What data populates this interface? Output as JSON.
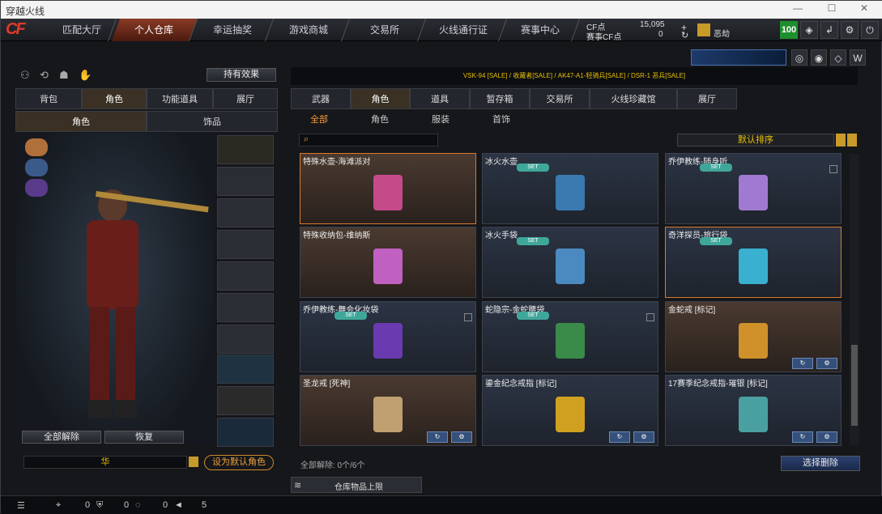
{
  "window": {
    "title": "穿越火线"
  },
  "nav": {
    "logo": "CF",
    "items": [
      "匹配大厅",
      "个人仓库",
      "幸运抽奖",
      "游戏商城",
      "交易所",
      "火线通行证",
      "赛事中心"
    ]
  },
  "currency": {
    "cf_label": "CF点",
    "cf_value": "15,095",
    "event_label": "赛事CF点",
    "event_value": "0",
    "user": "恶劫",
    "level": "100"
  },
  "left": {
    "effect_btn": "持有效果",
    "tabs": [
      "背包",
      "角色",
      "功能道具",
      "展厅"
    ],
    "subtabs": [
      "角色",
      "饰品"
    ],
    "unequip_all": "全部解除",
    "restore": "恢复",
    "char_name": "华",
    "set_default": "设为默认角色"
  },
  "right": {
    "promo": "VSK-94 [SALE] / 收藏者[SALE] / AK47-A1-轻骑兵[SALE] / DSR-1 恶兵[SALE]",
    "tabs": [
      "武器",
      "角色",
      "道具",
      "暂存箱",
      "交易所",
      "火线珍藏馆",
      "展厅"
    ],
    "subtabs": [
      "全部",
      "角色",
      "服装",
      "首饰"
    ],
    "sort": "默认排序",
    "unequip_label": "全部解除: 0个/6个",
    "select_delete": "选择删除",
    "capacity": "仓库物品上限"
  },
  "items": [
    {
      "name": "特殊水壶-海滩派对",
      "set": "",
      "color": "#c44a8a"
    },
    {
      "name": "冰火水壶",
      "set": "SET",
      "color": "#3a7ab0"
    },
    {
      "name": "乔伊教练-随身听",
      "set": "SET",
      "color": "#a07ad0"
    },
    {
      "name": "特殊收纳包-维纳斯",
      "set": "",
      "color": "#c060c0"
    },
    {
      "name": "冰火手袋",
      "set": "SET",
      "color": "#4a8ac0"
    },
    {
      "name": "奇洋探员-旅行袋",
      "set": "SET",
      "color": "#3ab0d0"
    },
    {
      "name": "乔伊教练-舞会化妆袋",
      "set": "SET",
      "color": "#6a3ab0"
    },
    {
      "name": "蛇隐宗-金蛇腰袋",
      "set": "SET",
      "color": "#3a8a4a"
    },
    {
      "name": "金蛇戒 [标记]",
      "set": "",
      "color": "#d0902a"
    },
    {
      "name": "圣龙戒 [死神]",
      "set": "",
      "color": "#c0a070"
    },
    {
      "name": "鎏金纪念戒指 [标记]",
      "set": "",
      "color": "#d0a020"
    },
    {
      "name": "17赛季纪念戒指-璀银 [标记]",
      "set": "",
      "color": "#4aa0a0"
    }
  ],
  "bottom": {
    "v1": "0",
    "v2": "0",
    "v3": "0",
    "v4": "5"
  }
}
